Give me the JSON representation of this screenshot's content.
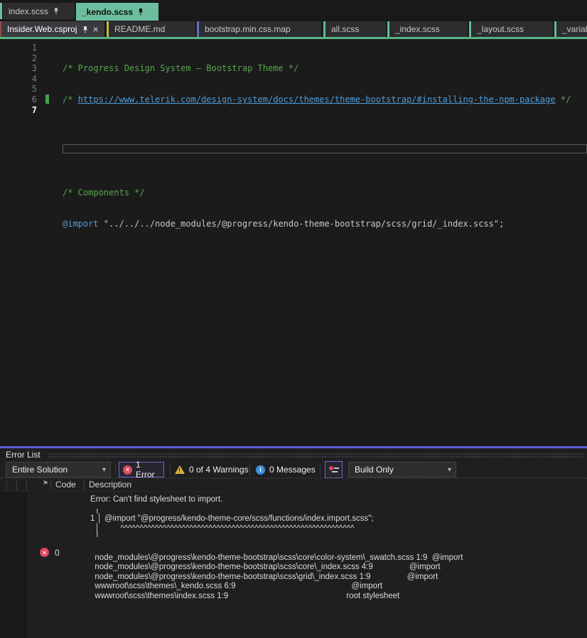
{
  "tab_rows": {
    "row1": [
      {
        "label": "index.scss",
        "pinned": true,
        "active": false
      },
      {
        "label": "_kendo.scss",
        "pinned": true,
        "active": true
      }
    ],
    "row2": [
      {
        "label": "Insider.Web.csproj",
        "pinned": true,
        "closable": true,
        "selected": true,
        "accent": "#8F4E44"
      },
      {
        "label": "README.md",
        "accent": "#BDBD3E"
      },
      {
        "label": "bootstrap.min.css.map",
        "accent": "#5577C8"
      },
      {
        "label": "all.scss",
        "accent": "#62BA92"
      },
      {
        "label": "_index.scss",
        "accent": "#62BA92"
      },
      {
        "label": "_layout.scss",
        "accent": "#62BA92"
      },
      {
        "label": "_variab",
        "accent": "#62BA92"
      }
    ]
  },
  "editor": {
    "line_numbers": [
      "1",
      "2",
      "3",
      "4",
      "5",
      "6",
      "7"
    ],
    "current_line": "7",
    "code": {
      "line1_comment": "/* Progress Design System – Bootstrap Theme */",
      "line2_open": "/* ",
      "line2_link": "https://www.telerik.com/design-system/docs/themes/theme-bootstrap/#installing-the-npm-package",
      "line2_close": " */",
      "line5_comment": "/* Components */",
      "line6_keyword": "@import",
      "line6_rest": " \"../../../node_modules/@progress/kendo-theme-bootstrap/scss/grid/_index.scss\";"
    }
  },
  "error_list": {
    "title": "Error List",
    "toolbar": {
      "scope_selected": "Entire Solution",
      "errors_label": "1 Error",
      "warnings_label": "0 of 4 Warnings",
      "messages_label": "0 Messages",
      "build_filter_selected": "Build Only"
    },
    "columns": {
      "code": "Code",
      "description": "Description"
    },
    "rows": [
      {
        "severity": "error",
        "code": "0",
        "description": "Error: Can't find stylesheet to import.\n  ╷\n1 │ @import \"@progress/kendo-theme-core/scss/functions/index.import.scss\";\n  │         ^^^^^^^^^^^^^^^^^^^^^^^^^^^^^^^^^^^^^^^^^^^^^^^^^^^^^^^^^^^^^\n  ╵\n\n  node_modules\\@progress\\kendo-theme-bootstrap\\scss\\core\\color-system\\_swatch.scss 1:9  @import\n  node_modules\\@progress\\kendo-theme-bootstrap\\scss\\core\\_index.scss 4:9                @import\n  node_modules\\@progress\\kendo-theme-bootstrap\\scss\\grid\\_index.scss 1:9                @import\n  wwwroot\\scss\\themes\\_kendo.scss 6:9                                                   @import\n  wwwroot\\scss\\themes\\index.scss 1:9                                                    root stylesheet"
      }
    ]
  },
  "icons": {
    "close_glyph": "×",
    "caret_down_glyph": "▾",
    "warning_glyph": "!",
    "info_glyph": "i",
    "error_glyph": "×",
    "header_flag_glyph": "⚑"
  },
  "colors": {
    "active_tab_green": "#6CBE9E",
    "tabstrip_line_green": "#57B287",
    "splitter_purple": "#5B5BD8",
    "selected_button_border_purple": "#6868D8",
    "error_red": "#E0485E",
    "warning_amber": "#DDB347",
    "info_blue": "#3F8FE0",
    "comment_green": "#57A64A",
    "link_blue": "#4E9CD6",
    "keyword_blue": "#569CD6",
    "string_gray": "#C8C8C8",
    "modified_line_green": "#47A348"
  }
}
